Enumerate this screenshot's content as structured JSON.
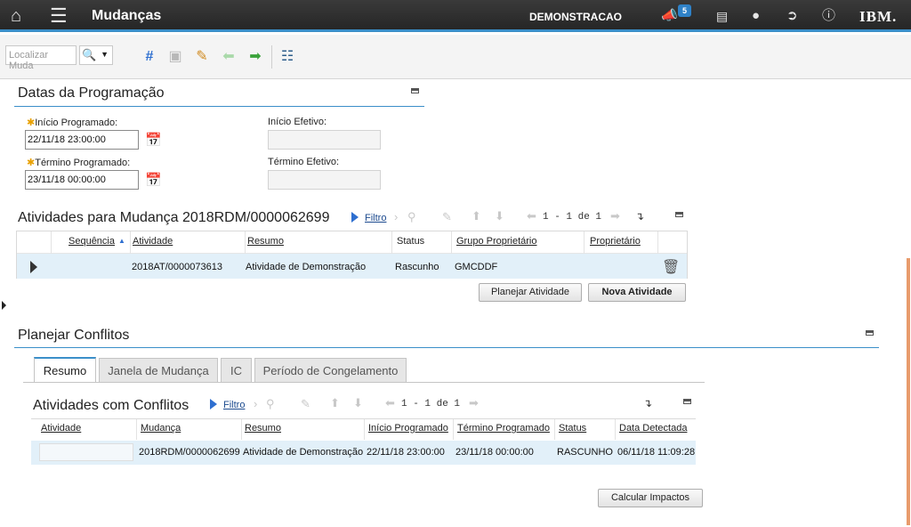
{
  "header": {
    "app_title": "Mudanças",
    "org": "DEMONSTRACAO",
    "notif_count": "5",
    "brand": "IBM."
  },
  "toolbar": {
    "search_placeholder": "Localizar Muda"
  },
  "datas": {
    "title": "Datas da Programação",
    "inicio_prog_label": "Início Programado:",
    "inicio_prog_value": "22/11/18 23:00:00",
    "termino_prog_label": "Término Programado:",
    "termino_prog_value": "23/11/18 00:00:00",
    "inicio_ef_label": "Início Efetivo:",
    "inicio_ef_value": "",
    "termino_ef_label": "Término Efetivo:",
    "termino_ef_value": ""
  },
  "atividades": {
    "title": "Atividades para Mudança 2018RDM/0000062699",
    "filter_label": "Filtro",
    "pager": "1 - 1 de 1",
    "columns": [
      "Sequência",
      "Atividade",
      "Resumo",
      "Status",
      "Grupo Proprietário",
      "Proprietário"
    ],
    "rows": [
      {
        "sequencia": "",
        "atividade": "2018AT/0000073613",
        "resumo": "Atividade de Demonstração",
        "status": "Rascunho",
        "grupo": "GMCDDF",
        "proprietario": ""
      }
    ],
    "btn_planejar": "Planejar Atividade",
    "btn_nova": "Nova Atividade"
  },
  "conflitos": {
    "title": "Planejar Conflitos",
    "tabs": [
      "Resumo",
      "Janela de Mudança",
      "IC",
      "Período de Congelamento"
    ],
    "sub_title": "Atividades com Conflitos",
    "filter_label": "Filtro",
    "pager": "1 - 1 de 1",
    "columns": [
      "Atividade",
      "Mudança",
      "Resumo",
      "Início Programado",
      "Término Programado",
      "Status",
      "Data Detectada"
    ],
    "rows": [
      {
        "atividade": "",
        "mudanca": "2018RDM/0000062699",
        "resumo": "Atividade de Demonstração",
        "inicio": "22/11/18 23:00:00",
        "termino": "23/11/18 00:00:00",
        "status": "RASCUNHO",
        "data": "06/11/18 11:09:28"
      }
    ],
    "btn_calcular": "Calcular Impactos"
  },
  "icons": [
    "home-icon",
    "menu-icon",
    "megaphone-icon",
    "chart-icon",
    "user-icon",
    "logout-icon",
    "help-icon",
    "search-icon",
    "new-icon",
    "save-icon",
    "clear-icon",
    "prev-icon",
    "next-icon",
    "workflow-icon",
    "calendar-icon",
    "delete-icon",
    "download-icon"
  ],
  "colors": {
    "accent": "#3b8fc9",
    "topbar": "#2c2c2c",
    "row_highlight": "#e2f0f9",
    "badge": "#2f82c8"
  }
}
